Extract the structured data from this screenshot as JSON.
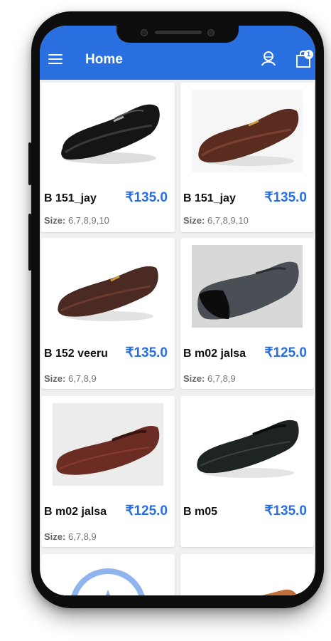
{
  "app": {
    "title": "Home",
    "cart_count": "1"
  },
  "icons": {
    "menu": "menu-icon",
    "user": "user-icon",
    "cart": "shopping-bag-icon"
  },
  "colors": {
    "accent": "#2a6fe0",
    "price": "#2a6fe0"
  },
  "size_label": "Size:",
  "products": [
    {
      "name": "B 151_jay",
      "price": "₹135.0",
      "sizes": "6,7,8,9,10",
      "shoe_color": "black"
    },
    {
      "name": "B 151_jay",
      "price": "₹135.0",
      "sizes": "6,7,8,9,10",
      "shoe_color": "brown"
    },
    {
      "name": "B 152 veeru",
      "price": "₹135.0",
      "sizes": "6,7,8,9",
      "shoe_color": "brown"
    },
    {
      "name": "B m02 jalsa",
      "price": "₹125.0",
      "sizes": "6,7,8,9",
      "shoe_color": "black-grey"
    },
    {
      "name": "B m02 jalsa",
      "price": "₹125.0",
      "sizes": "6,7,8,9",
      "shoe_color": "brown"
    },
    {
      "name": "B m05",
      "price": "₹135.0",
      "sizes": "",
      "shoe_color": "black"
    }
  ]
}
